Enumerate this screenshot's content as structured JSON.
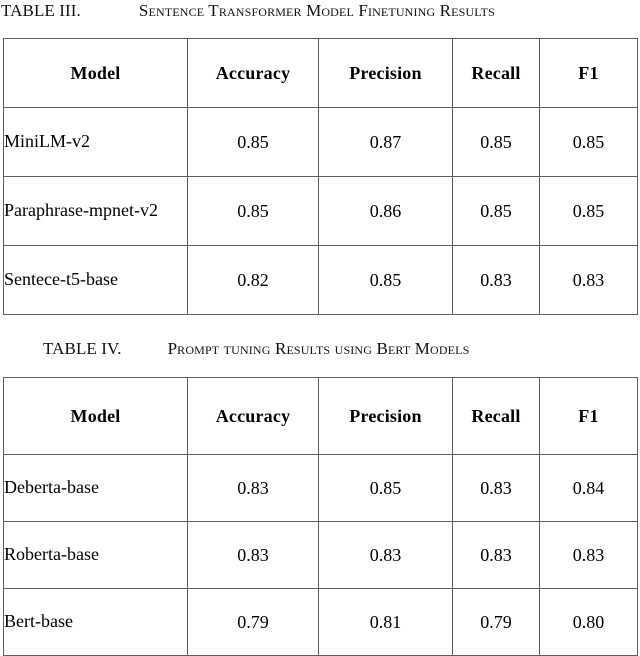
{
  "tables": [
    {
      "label": "TABLE III.",
      "title": "Sentence Transformer Model Finetuning Results",
      "columns": [
        "Model",
        "Accuracy",
        "Precision",
        "Recall",
        "F1"
      ],
      "rows": [
        {
          "model": "MiniLM-v2",
          "accuracy": "0.85",
          "precision": "0.87",
          "recall": "0.85",
          "f1": "0.85"
        },
        {
          "model": "Paraphrase-mpnet-v2",
          "accuracy": "0.85",
          "precision": "0.86",
          "recall": "0.85",
          "f1": "0.85"
        },
        {
          "model": "Sentece-t5-base",
          "accuracy": "0.82",
          "precision": "0.85",
          "recall": "0.83",
          "f1": "0.83"
        }
      ]
    },
    {
      "label": "TABLE IV.",
      "title": "Prompt tuning Results using Bert Models",
      "columns": [
        "Model",
        "Accuracy",
        "Precision",
        "Recall",
        "F1"
      ],
      "rows": [
        {
          "model": "Deberta-base",
          "accuracy": "0.83",
          "precision": "0.85",
          "recall": "0.83",
          "f1": "0.84"
        },
        {
          "model": "Roberta-base",
          "accuracy": "0.83",
          "precision": "0.83",
          "recall": "0.83",
          "f1": "0.83"
        },
        {
          "model": "Bert-base",
          "accuracy": "0.79",
          "precision": "0.81",
          "recall": "0.79",
          "f1": "0.80"
        }
      ]
    }
  ],
  "colors": {
    "page_background": "#ffffff",
    "text": "#000000",
    "table_border": "#5f5f5f"
  }
}
